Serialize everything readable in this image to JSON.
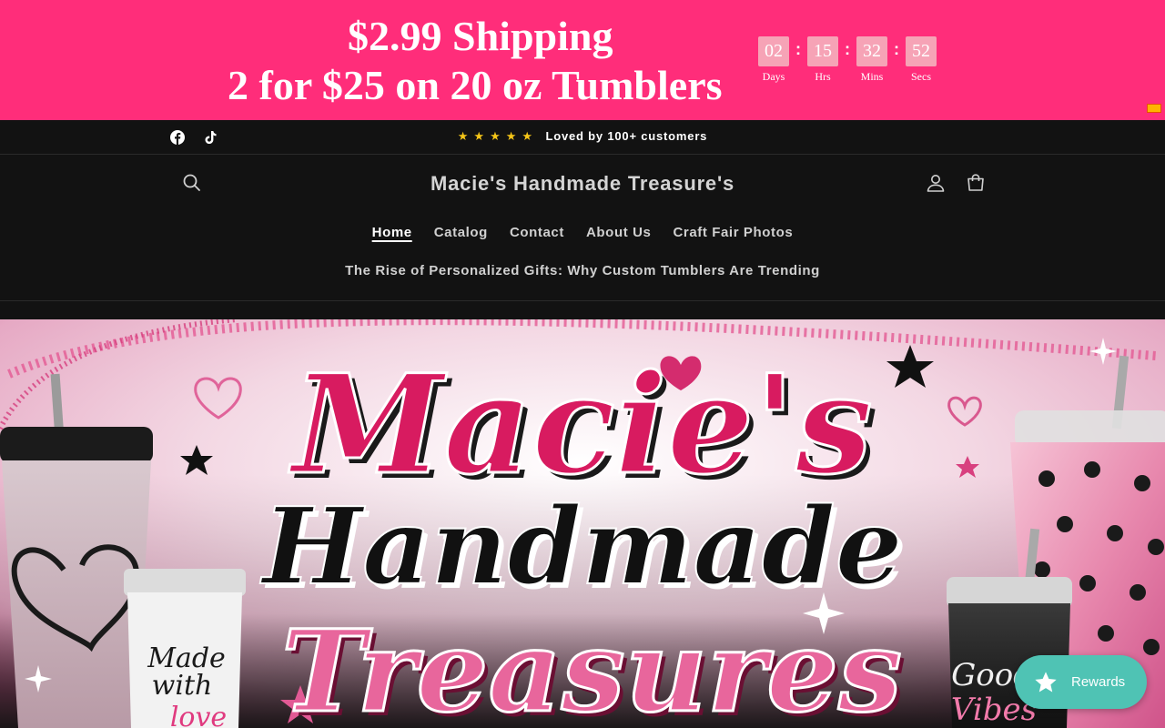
{
  "promo": {
    "line1": "$2.99 Shipping",
    "line2": "2 for $25 on 20 oz Tumblers",
    "countdown": [
      {
        "value": "02",
        "label": "Days"
      },
      {
        "value": "15",
        "label": "Hrs"
      },
      {
        "value": "32",
        "label": "Mins"
      },
      {
        "value": "52",
        "label": "Secs"
      }
    ],
    "separator": ":",
    "background": "#ff2d7a"
  },
  "announcement": {
    "stars": "★★★★★",
    "text": "Loved by 100+ customers",
    "social_icons": [
      "facebook-icon",
      "tiktok-icon"
    ]
  },
  "header": {
    "logo": "Macie's Handmade Treasure's",
    "nav": [
      "Home",
      "Catalog",
      "Contact",
      "About Us",
      "Craft Fair Photos"
    ],
    "nav_secondary": "The Rise of Personalized Gifts: Why Custom Tumblers Are Trending",
    "icons": [
      "search-icon",
      "account-icon",
      "cart-icon"
    ]
  },
  "hero": {
    "line1": "Macie's",
    "line2": "Handmade",
    "line3": "Treasures",
    "tumbler_left_text": [
      "Made",
      "with",
      "love"
    ],
    "tumbler_right_text": [
      "Good",
      "Vibes"
    ]
  },
  "rewards": {
    "label": "Rewards",
    "color": "#4fc3b4"
  }
}
